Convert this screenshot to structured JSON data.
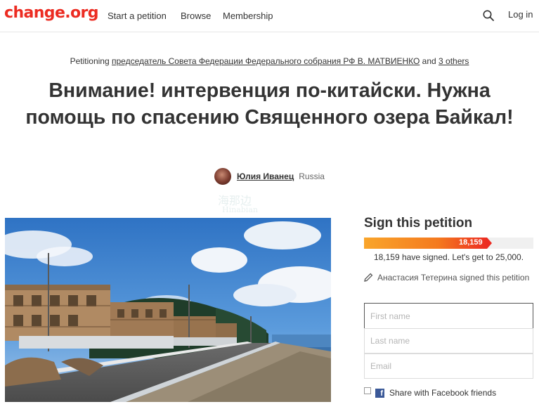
{
  "header": {
    "logo": "change.org",
    "nav": {
      "start": "Start a petition",
      "browse": "Browse",
      "membership": "Membership"
    },
    "login": "Log in",
    "search_icon": "search-icon"
  },
  "petition": {
    "petitioning_prefix": "Petitioning",
    "target": "председатель Совета Федерации Федерального собрания РФ В. МАТВИЕНКО",
    "and_text": "and",
    "others": "3 others",
    "title": "Внимание! интервенция по-китайски. Нужна помощь по спасению Священного озера Байкал!",
    "author_name": "Юлия Иванец",
    "author_country": "Russia"
  },
  "watermark": {
    "line1": "海那边",
    "line2": "Hinabian"
  },
  "sign": {
    "title": "Sign this petition",
    "signed": 18159,
    "goal": 25000,
    "bar_label": "18,159",
    "count_text": "18,159 have signed. Let's get to 25,000.",
    "recent_signer": "Анастасия Тетерина signed this petition",
    "first_name_placeholder": "First name",
    "last_name_placeholder": "Last name",
    "email_placeholder": "Email",
    "facebook_label": "Share with Facebook friends"
  },
  "colors": {
    "brand": "#ec2c22",
    "progress_start": "#f9a52b",
    "facebook": "#3b5998"
  }
}
